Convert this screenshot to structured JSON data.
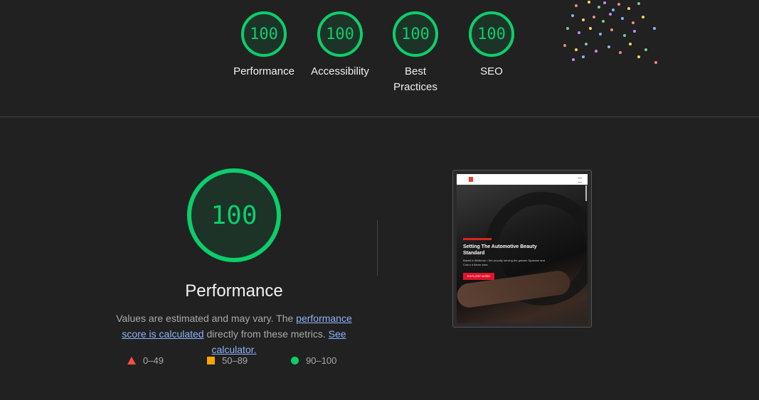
{
  "categories": [
    {
      "score": "100",
      "label": "Performance"
    },
    {
      "score": "100",
      "label": "Accessibility"
    },
    {
      "score": "100",
      "label": "Best Practices"
    },
    {
      "score": "100",
      "label": "SEO"
    }
  ],
  "performance": {
    "score": "100",
    "title": "Performance",
    "desc_text_1": "Values are estimated and may vary. The ",
    "desc_link_1": "performance score is calculated",
    "desc_text_2": " directly from these metrics. ",
    "desc_link_2": "See calculator."
  },
  "legend": {
    "fail": "0–49",
    "average": "50–89",
    "pass": "90–100"
  },
  "screenshot": {
    "title": "Setting The Automotive Beauty Standard",
    "subtitle": "Based in Bellevue • We proudly serving the greater Spokane and Coeur d'Alene area.",
    "button": "EXPLORE MORE"
  },
  "colors": {
    "pass": "#0cce6b",
    "average": "#ffa400",
    "fail": "#ff4e42",
    "background": "#212121",
    "link": "#8ab4f8"
  }
}
